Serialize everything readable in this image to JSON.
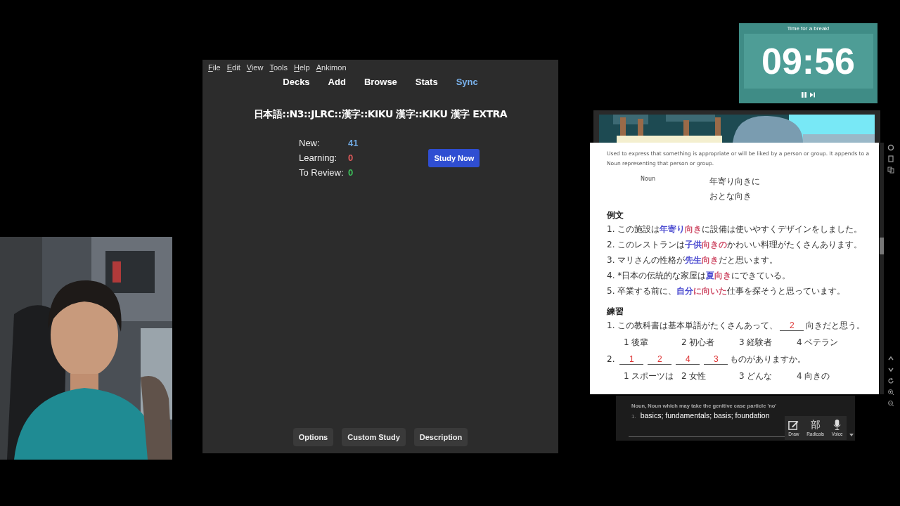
{
  "anki": {
    "menu": [
      "File",
      "Edit",
      "View",
      "Tools",
      "Help",
      "Ankimon"
    ],
    "nav": [
      {
        "label": "Decks",
        "highlighted": false
      },
      {
        "label": "Add",
        "highlighted": false
      },
      {
        "label": "Browse",
        "highlighted": false
      },
      {
        "label": "Stats",
        "highlighted": false
      },
      {
        "label": "Sync",
        "highlighted": true
      }
    ],
    "deck_title": "日本語::N3::JLRC::漢字::KIKU 漢字::KIKU 漢字 EXTRA",
    "counts": [
      {
        "label": "New:",
        "value": "41",
        "color": "#6fa8e0"
      },
      {
        "label": "Learning:",
        "value": "0",
        "color": "#e05a5a"
      },
      {
        "label": "To Review:",
        "value": "0",
        "color": "#3cc05a"
      }
    ],
    "study_button": "Study Now",
    "bottom_buttons": [
      "Options",
      "Custom Study",
      "Description"
    ]
  },
  "timer": {
    "title": "Time for a break!",
    "time": "09:56"
  },
  "document": {
    "definition": "Used to express that something is appropriate or will be liked by a person or group. It appends to a Noun representing that person or group.",
    "pattern": {
      "label": "Noun",
      "examples": [
        "年寄り向きに",
        "おとな向き"
      ]
    },
    "examples_heading": "例文",
    "examples": [
      {
        "number": "1.",
        "segments": [
          {
            "text": "この施設は"
          },
          {
            "text": "年寄り",
            "color": "#4a4ad0"
          },
          {
            "text": "向き",
            "color": "#d0506a"
          },
          {
            "text": "に設備は使いやすくデザインをしました。"
          }
        ]
      },
      {
        "number": "2.",
        "segments": [
          {
            "text": "このレストランは"
          },
          {
            "text": "子供",
            "color": "#4a4ad0"
          },
          {
            "text": "向きの",
            "color": "#d0506a"
          },
          {
            "text": "かわいい料理がたくさんあります。"
          }
        ]
      },
      {
        "number": "3.",
        "segments": [
          {
            "text": "マリさんの性格が"
          },
          {
            "text": "先生",
            "color": "#4a4ad0"
          },
          {
            "text": "向き",
            "color": "#d0506a"
          },
          {
            "text": "だと思います。"
          }
        ]
      },
      {
        "number": "4.",
        "segments": [
          {
            "text": "*日本の伝統的な家屋は"
          },
          {
            "text": "夏",
            "color": "#4a4ad0"
          },
          {
            "text": "向き",
            "color": "#d0506a"
          },
          {
            "text": "にできている。"
          }
        ]
      },
      {
        "number": "5.",
        "segments": [
          {
            "text": "卒業する前に、"
          },
          {
            "text": "自分",
            "color": "#4a4ad0"
          },
          {
            "text": "に向いた",
            "color": "#d0506a"
          },
          {
            "text": "仕事を探そうと思っています。"
          }
        ]
      }
    ],
    "practice_heading": "練習",
    "questions": [
      {
        "number": "1.",
        "segments": [
          {
            "text": "この教科書は基本単語がたくさんあって、"
          },
          {
            "kind": "blank",
            "text": "2"
          },
          {
            "text": "向きだと思う。"
          }
        ],
        "options": [
          {
            "number": "1",
            "text": "後輩"
          },
          {
            "number": "2",
            "text": "初心者"
          },
          {
            "number": "3",
            "text": "経験者"
          },
          {
            "number": "4",
            "text": "ベテラン"
          }
        ]
      },
      {
        "number": "2.",
        "segments": [
          {
            "kind": "blank",
            "text": "1"
          },
          {
            "kind": "blank",
            "text": "2"
          },
          {
            "kind": "blank",
            "text": "4"
          },
          {
            "kind": "blank",
            "text": "3"
          },
          {
            "text": "ものがありますか。"
          }
        ],
        "options": [
          {
            "number": "1",
            "text": "スポーツは"
          },
          {
            "number": "2",
            "text": "女性"
          },
          {
            "number": "3",
            "text": "どんな"
          },
          {
            "number": "4",
            "text": "向きの"
          }
        ]
      }
    ]
  },
  "dictionary": {
    "part_of_speech": "Noun, Noun which may take the genitive case particle 'no'",
    "meanings": [
      {
        "number": "1.",
        "text": "basics; fundamentals; basis; foundation"
      }
    ],
    "tools": [
      {
        "kind": "draw",
        "label": "Draw"
      },
      {
        "kind": "radicals",
        "label": "Radicals",
        "glyph": "部"
      },
      {
        "kind": "voice",
        "label": "Voice"
      }
    ]
  }
}
